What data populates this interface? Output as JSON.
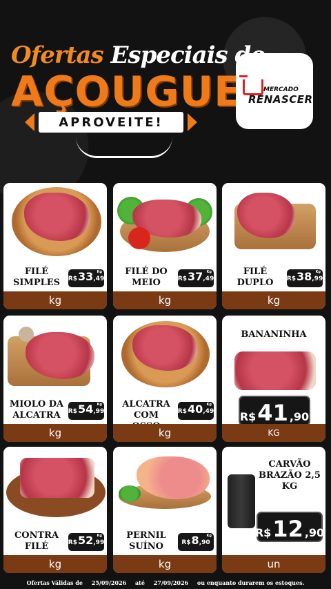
{
  "header": {
    "title_word1": "Ofertas",
    "title_word2": "Especiais de",
    "title_main": "AÇOUGUE",
    "ribbon": "APROVEITE!"
  },
  "logo": {
    "line1": "MERCADO",
    "line2": "RENASCER"
  },
  "products": [
    {
      "name": "FILÉ SIMPLES",
      "currency": "R$",
      "int": "33",
      "cents": ",49",
      "tag_unit": "Kg",
      "unit": "kg"
    },
    {
      "name": "FILÉ DO MEIO",
      "currency": "R$",
      "int": "37",
      "cents": ",49",
      "tag_unit": "Kg",
      "unit": "kg"
    },
    {
      "name": "FILÉ DUPLO",
      "currency": "R$",
      "int": "38",
      "cents": ",99",
      "tag_unit": "Kg",
      "unit": "kg"
    },
    {
      "name": "MIOLO DA ALCATRA",
      "currency": "R$",
      "int": "54",
      "cents": ",99",
      "tag_unit": "Kg",
      "unit": "kg"
    },
    {
      "name": "ALCATRA COM OSSO",
      "currency": "R$",
      "int": "40",
      "cents": ",49",
      "tag_unit": "Kg",
      "unit": "kg"
    },
    {
      "name": "BANANINHA",
      "currency": "R$",
      "int": "41",
      "cents": ",90",
      "unit": "KG"
    },
    {
      "name": "CONTRA FILÉ",
      "currency": "R$",
      "int": "52",
      "cents": ",99",
      "tag_unit": "Kg",
      "unit": "kg"
    },
    {
      "name": "PERNIL SUÍNO",
      "currency": "R$",
      "int": "8",
      "cents": ",90",
      "tag_unit": "Kg",
      "unit": "kg"
    },
    {
      "name": "CARVÃO BRAZÃO 2,5 KG",
      "currency": "R$",
      "int": "12",
      "cents": ",90",
      "unit": "un"
    }
  ],
  "footer": {
    "prefix": "Ofertas Válidas de",
    "date_from": "25/09/2026",
    "connector": "até",
    "date_to": "27/09/2026",
    "suffix": "ou enquanto durarem os estoques."
  },
  "colors": {
    "accent": "#ee7a1a",
    "unit_bar": "#7a3a14",
    "background": "#121212"
  }
}
